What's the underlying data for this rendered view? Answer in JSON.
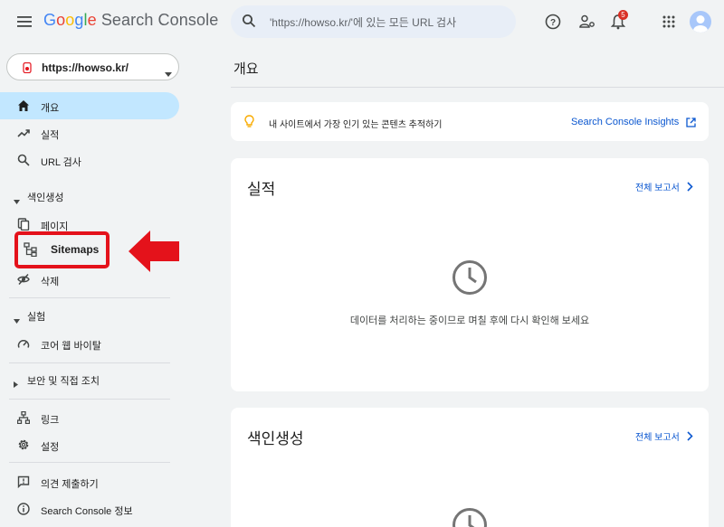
{
  "header": {
    "logo_letters": [
      "G",
      "o",
      "o",
      "g",
      "l",
      "e"
    ],
    "product": "Search Console",
    "search_placeholder": "'https://howso.kr/'에 있는 모든 URL 검사",
    "notification_count": "5"
  },
  "property": {
    "label": "https://howso.kr/"
  },
  "sidebar": {
    "items": {
      "overview": "개요",
      "performance": "실적",
      "url_inspection": "URL 검사",
      "indexing_section": "색인생성",
      "pages": "페이지",
      "sitemaps": "Sitemaps",
      "removals": "삭제",
      "experience_section": "실험",
      "core_web_vitals": "코어 웹 바이탈",
      "security_section": "보안 및 직접 조치",
      "links": "링크",
      "settings": "설정",
      "feedback": "의견 제출하기",
      "about": "Search Console 정보"
    }
  },
  "main": {
    "title": "개요",
    "tip": {
      "text": "내 사이트에서 가장 인기 있는 콘텐츠 추적하기",
      "link": "Search Console Insights"
    },
    "performance_card": {
      "title": "실적",
      "link": "전체 보고서",
      "message": "데이터를 처리하는 중이므로 며칠 후에 다시 확인해 보세요"
    },
    "indexing_card": {
      "title": "색인생성",
      "link": "전체 보고서"
    }
  },
  "colors": {
    "accent": "#0b57d0",
    "active_nav": "#c2e7ff",
    "highlight": "#e4121b",
    "search_bg": "#e8eef7"
  }
}
